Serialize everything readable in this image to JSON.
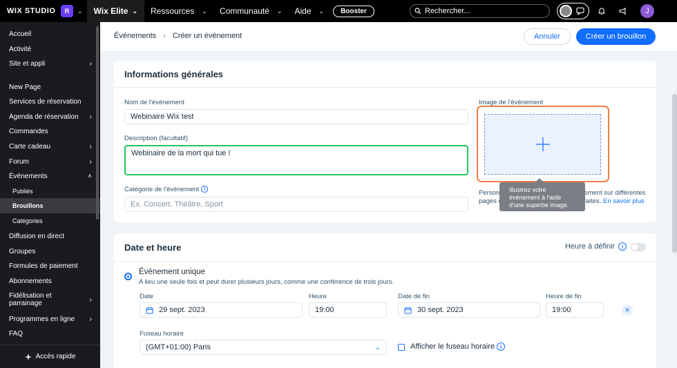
{
  "topbar": {
    "logo": "WIX STUDIO",
    "site_initial": "R",
    "plan": "Wix Elite",
    "nav": [
      "Ressources",
      "Communauté",
      "Aide"
    ],
    "booster": "Booster",
    "search_placeholder": "Rechercher...",
    "user_initial": "J"
  },
  "sidebar": {
    "items": [
      {
        "label": "Accueil",
        "chevron": false
      },
      {
        "label": "Activité",
        "chevron": false
      },
      {
        "label": "Site et appli",
        "chevron": true
      },
      {
        "label": "New Page",
        "chevron": false
      },
      {
        "label": "Services de réservation",
        "chevron": false
      },
      {
        "label": "Agenda de réservation",
        "chevron": true
      },
      {
        "label": "Commandes",
        "chevron": false
      },
      {
        "label": "Carte cadeau",
        "chevron": true
      },
      {
        "label": "Forum",
        "chevron": true
      },
      {
        "label": "Événements",
        "chevron": "open"
      },
      {
        "label": "Publiés",
        "sub": true
      },
      {
        "label": "Brouillons",
        "sub": true,
        "active": true
      },
      {
        "label": "Catégories",
        "sub": true
      },
      {
        "label": "Diffusion en direct",
        "chevron": false
      },
      {
        "label": "Groupes",
        "chevron": false
      },
      {
        "label": "Formules de paiement",
        "chevron": false
      },
      {
        "label": "Abonnements",
        "chevron": false
      },
      {
        "label": "Fidélisation et parrainage",
        "chevron": true
      },
      {
        "label": "Programmes en ligne",
        "chevron": true
      },
      {
        "label": "FAQ",
        "chevron": false
      }
    ],
    "quick_access": "Accès rapide"
  },
  "header": {
    "breadcrumb": [
      "Événements",
      "Créer un événement"
    ],
    "cancel": "Annuler",
    "create_draft": "Créer un brouillon"
  },
  "general": {
    "title": "Informations générales",
    "name_label": "Nom de l'événement",
    "name_value": "Webinaire Wix test",
    "description_label": "Description (facultatif)",
    "description_value": "Webinaire de la mort qui tue !",
    "category_label": "Catégorie de l'événement",
    "category_placeholder": "Ex. Concert, Théâtre, Sport",
    "image_label": "Image de l'événement",
    "image_desc_1": "Personnalisez l'image de votre événement sur différentes",
    "image_desc_2": "pages et trouvez les dimensions parfaites.",
    "learn_more": "En savoir plus",
    "tooltip_1": "Illustrez votre",
    "tooltip_2": "événement à l'aide",
    "tooltip_3": "d'une superbe image."
  },
  "datetime": {
    "title": "Date et heure",
    "tbd_label": "Heure à définir",
    "single_event": "Événement unique",
    "single_event_desc": "A lieu une seule fois et peut durer plusieurs jours, comme une conférence de trois jours.",
    "start_date_label": "Date",
    "start_date": "29 sept. 2023",
    "start_time_label": "Heure",
    "start_time": "19:00",
    "end_date_label": "Date de fin",
    "end_date": "30 sept. 2023",
    "end_time_label": "Heure de fin",
    "end_time": "19:00",
    "timezone_label": "Fuseau horaire",
    "timezone": "(GMT+01:00) Paris",
    "show_timezone": "Afficher le fuseau horaire"
  },
  "colors": {
    "accent": "#116dff",
    "focus_green": "#22c55e",
    "highlight_orange": "#f07c45"
  }
}
